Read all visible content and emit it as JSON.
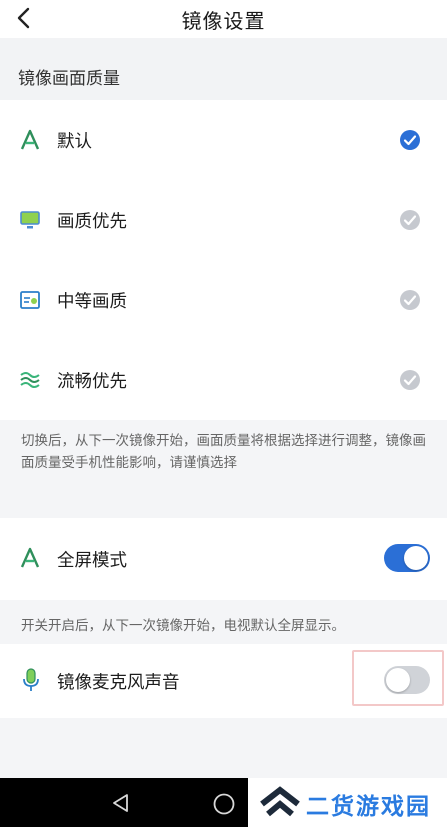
{
  "header": {
    "title": "镜像设置",
    "back_icon": "chevron-left-icon"
  },
  "quality": {
    "section_title": "镜像画面质量",
    "options": [
      {
        "label": "默认",
        "icon": "a-letter-icon",
        "selected": true
      },
      {
        "label": "画质优先",
        "icon": "monitor-icon",
        "selected": false
      },
      {
        "label": "中等画质",
        "icon": "screen-medium-icon",
        "selected": false
      },
      {
        "label": "流畅优先",
        "icon": "waves-icon",
        "selected": false
      }
    ],
    "hint": "切换后，从下一次镜像开始，画面质量将根据选择进行调整，镜像画面质量受手机性能影响，请谨慎选择"
  },
  "fullscreen": {
    "label": "全屏模式",
    "enabled": true,
    "hint": "开关开启后，从下一次镜像开始，电视默认全屏显示。"
  },
  "mic": {
    "label": "镜像麦克风声音",
    "enabled": false
  },
  "watermark": {
    "text": "二货游戏园"
  },
  "colors": {
    "accent": "#2b6fd6",
    "check_inactive": "#c6c9cf",
    "toggle_off": "#d0d3d8",
    "watermark": "#2a7be0"
  }
}
